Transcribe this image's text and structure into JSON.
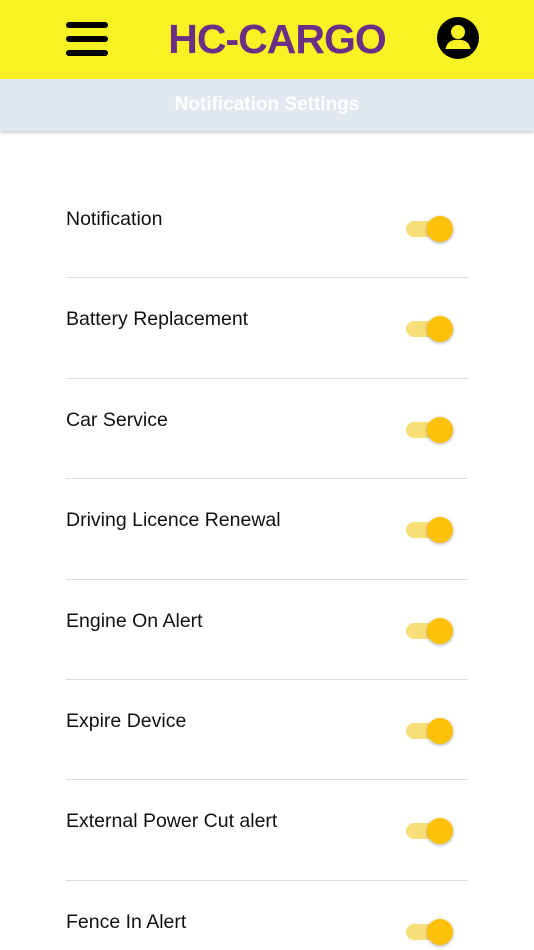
{
  "header": {
    "brand": "HC-CARGO",
    "menu_icon": "hamburger-menu-icon",
    "account_icon": "account-circle-icon",
    "background": "#f8f123",
    "brand_color": "#6b2e87"
  },
  "subheader": {
    "title": "Notification Settings"
  },
  "settings": [
    {
      "label": "Notification",
      "enabled": true
    },
    {
      "label": "Battery Replacement",
      "enabled": true
    },
    {
      "label": "Car Service",
      "enabled": true
    },
    {
      "label": "Driving Licence Renewal",
      "enabled": true
    },
    {
      "label": "Engine On Alert",
      "enabled": true
    },
    {
      "label": "Expire Device",
      "enabled": true
    },
    {
      "label": "External Power Cut alert",
      "enabled": true
    },
    {
      "label": "Fence In Alert",
      "enabled": true
    }
  ],
  "colors": {
    "toggle_on_thumb": "#ffc107",
    "toggle_on_track": "#f8df7a"
  }
}
